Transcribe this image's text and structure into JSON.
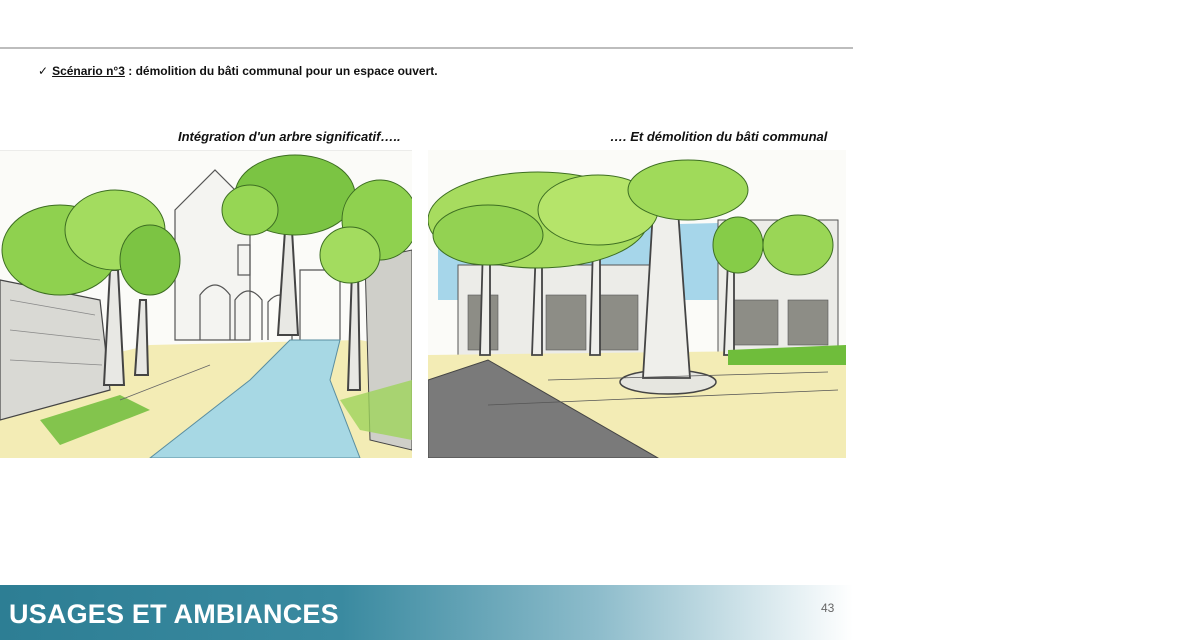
{
  "scenario": {
    "checkmark": "✓",
    "label": "Scénario n°3",
    "separator": " : ",
    "description": "démolition du bâti communal pour un espace ouvert."
  },
  "images": {
    "left": {
      "caption": "Intégration d'un arbre significatif….."
    },
    "right": {
      "caption": "…. Et démolition du bâti communal"
    }
  },
  "footer": {
    "title": "USAGES ET AMBIANCES",
    "page_number": "43"
  },
  "colors": {
    "footer_start": "#2d7e94",
    "footer_end": "#ffffff",
    "foliage": "#8fd14f",
    "path": "#9fd3df"
  }
}
